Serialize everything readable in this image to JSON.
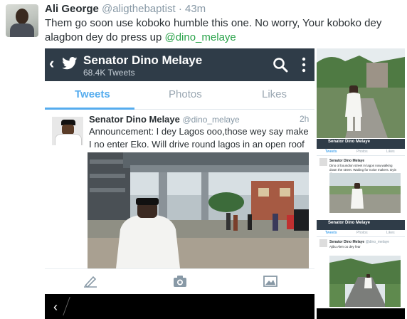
{
  "outer_tweet": {
    "name": "Ali George",
    "handle": "@aligthebaptist",
    "separator": "·",
    "time": "43m",
    "text": "Them go soon use koboko humble this one. No worry,  Your koboko dey alagbon dey do press up",
    "mention": "@dino_melaye"
  },
  "screenshot": {
    "app_bar": {
      "back_icon": "chevron-left-icon",
      "logo_icon": "twitter-bird-icon",
      "title": "Senator Dino Melaye",
      "subtitle": "68.4K Tweets",
      "search_icon": "search-icon",
      "menu_icon": "overflow-menu-icon"
    },
    "tabs": [
      {
        "label": "Tweets",
        "active": true
      },
      {
        "label": "Photos",
        "active": false
      },
      {
        "label": "Likes",
        "active": false
      }
    ],
    "tweet": {
      "name": "Senator Dino Melaye",
      "handle": "@dino_melaye",
      "time": "2h",
      "text": "Announcement: I dey Lagos ooo,those wey  say make I no enter Eko. Will drive round lagos in an open roof"
    },
    "toolbar": [
      "compose-icon",
      "camera-icon",
      "image-icon"
    ],
    "nav_back": "‹"
  },
  "thumbnails": [
    {
      "kind": "photo",
      "description_icon": "photo-thumbnail-icon"
    },
    {
      "kind": "screenshot",
      "title": "Senator Dino Melaye",
      "subtitle": "68.4K Tweets",
      "tabs": [
        "Tweets",
        "Photos",
        "Likes"
      ],
      "name": "Senator Dino Melaye",
      "text": "Dino ol boundion street in lagos now,walking down the street. Waiting for noise makers. Dyin dis?"
    },
    {
      "kind": "screenshot",
      "title": "Senator Dino Melaye",
      "subtitle": "68.4K Tweets",
      "tabs": [
        "Tweets",
        "Photos",
        "Likes"
      ],
      "name": "Senator Dino Melaye",
      "handle": "@dino_melaye",
      "text": "Ajibu Alen oo dey fear"
    }
  ],
  "colors": {
    "app_bar": "#2f3c48",
    "twitter_blue": "#55acee",
    "mention_green": "#2aa34a",
    "meta_gray": "#8899a6",
    "text": "#292f33"
  }
}
